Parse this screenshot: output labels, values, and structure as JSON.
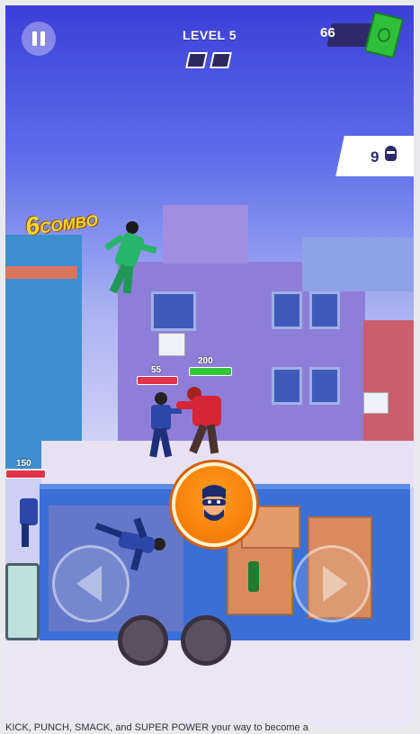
{
  "hud": {
    "level_label": "LEVEL 5",
    "cash": "66",
    "enemies_remaining": "9",
    "combo_number": "6",
    "combo_word": "COMBO",
    "stage_progress": {
      "completed": 0,
      "total": 2
    }
  },
  "fighters": {
    "cop_left_hp": "55",
    "red_player_hp": "200",
    "cop_edge_hp": "150"
  },
  "icons": {
    "pause": "pause-icon",
    "cash": "cash-icon",
    "enemy": "enemy-head-icon",
    "power": "super-power-icon",
    "left": "arrow-left-icon",
    "right": "arrow-right-icon"
  },
  "colors": {
    "power_button": "#f07100",
    "hp_player": "#35c43a",
    "hp_enemy": "#e2334a"
  },
  "caption": "KICK, PUNCH, SMACK, and SUPER POWER your way to become a"
}
